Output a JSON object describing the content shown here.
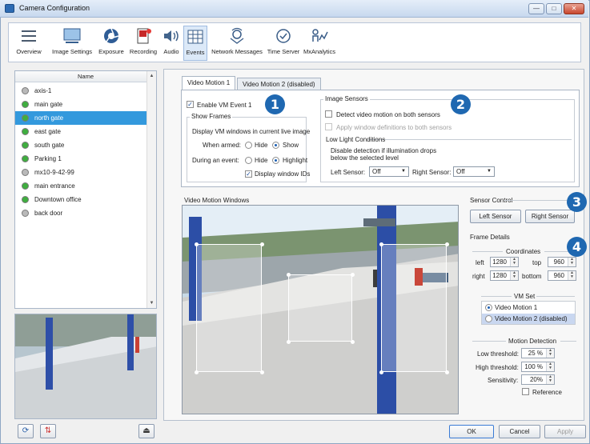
{
  "window": {
    "title": "Camera Configuration",
    "min_label": "—",
    "max_label": "□",
    "close_label": "✕"
  },
  "toolbar": {
    "items": [
      {
        "label": "Overview",
        "icon": "overview-icon"
      },
      {
        "label": "Image Settings",
        "icon": "image-settings-icon"
      },
      {
        "label": "Exposure",
        "icon": "exposure-icon"
      },
      {
        "label": "Recording",
        "icon": "recording-icon"
      },
      {
        "label": "Audio",
        "icon": "audio-icon"
      },
      {
        "label": "Events",
        "icon": "events-icon"
      },
      {
        "label": "Network Messages",
        "icon": "network-messages-icon"
      },
      {
        "label": "Time Server",
        "icon": "time-server-icon"
      },
      {
        "label": "MxAnalytics",
        "icon": "mxanalytics-icon"
      }
    ],
    "active": "Events"
  },
  "camera_list": {
    "header": "Name",
    "items": [
      {
        "name": "axis-1",
        "status": "#b9b9b9"
      },
      {
        "name": "main gate",
        "status": "#3fae3f"
      },
      {
        "name": "north gate",
        "status": "#3fae3f",
        "selected": true
      },
      {
        "name": "east gate",
        "status": "#3fae3f"
      },
      {
        "name": "south gate",
        "status": "#3fae3f"
      },
      {
        "name": "Parking 1",
        "status": "#3fae3f"
      },
      {
        "name": "mx10-9-42-99",
        "status": "#b9b9b9"
      },
      {
        "name": "main entrance",
        "status": "#3fae3f"
      },
      {
        "name": "Downtown office",
        "status": "#3fae3f"
      },
      {
        "name": "back door",
        "status": "#b9b9b9"
      }
    ]
  },
  "tabs": [
    {
      "label": "Video Motion 1",
      "active": true
    },
    {
      "label": "Video Motion 2  (disabled)",
      "active": false
    }
  ],
  "vm_event": {
    "enable_label": "Enable VM Event 1",
    "show_frames_title": "Show Frames",
    "display_text": "Display VM windows in current live image",
    "when_armed_label": "When armed:",
    "during_event_label": "During an event:",
    "hide_label": "Hide",
    "show_label": "Show",
    "highlight_label": "Highlight",
    "display_ids_label": "Display window IDs"
  },
  "image_sensors": {
    "title": "Image Sensors",
    "detect_both_label": "Detect video motion on both sensors",
    "apply_both_label": "Apply window definitions to both sensors",
    "low_light_title": "Low Light Conditions",
    "low_light_desc_1": "Disable detection if illumination drops",
    "low_light_desc_2": "below the selected level",
    "left_sensor_label": "Left Sensor:",
    "left_sensor_value": "Off",
    "right_sensor_label": "Right Sensor:",
    "right_sensor_value": "Off"
  },
  "video_windows_title": "Video Motion Windows",
  "sensor_control": {
    "title": "Sensor Control",
    "left_button": "Left Sensor",
    "right_button": "Right Sensor"
  },
  "frame_details": {
    "title": "Frame Details",
    "coordinates_title": "Coordinates",
    "left_label": "left",
    "left_value": "1280",
    "top_label": "top",
    "top_value": "960",
    "right_label": "right",
    "right_value": "1280",
    "bottom_label": "bottom",
    "bottom_value": "960"
  },
  "vm_set": {
    "title": "VM Set",
    "option1": "Video Motion 1",
    "option2": "Video Motion 2  (disabled)"
  },
  "motion_detection": {
    "title": "Motion Detection",
    "low_label": "Low threshold:",
    "low_value": "25 %",
    "high_label": "High threshold:",
    "high_value": "100 %",
    "sens_label": "Sensitivity:",
    "sens_value": "20%",
    "reference_label": "Reference"
  },
  "badges": [
    "1",
    "2",
    "3",
    "4"
  ],
  "footer": {
    "ok": "OK",
    "cancel": "Cancel",
    "apply": "Apply"
  },
  "colors": {
    "accent": "#1f68b1",
    "selection": "#3399dd"
  }
}
